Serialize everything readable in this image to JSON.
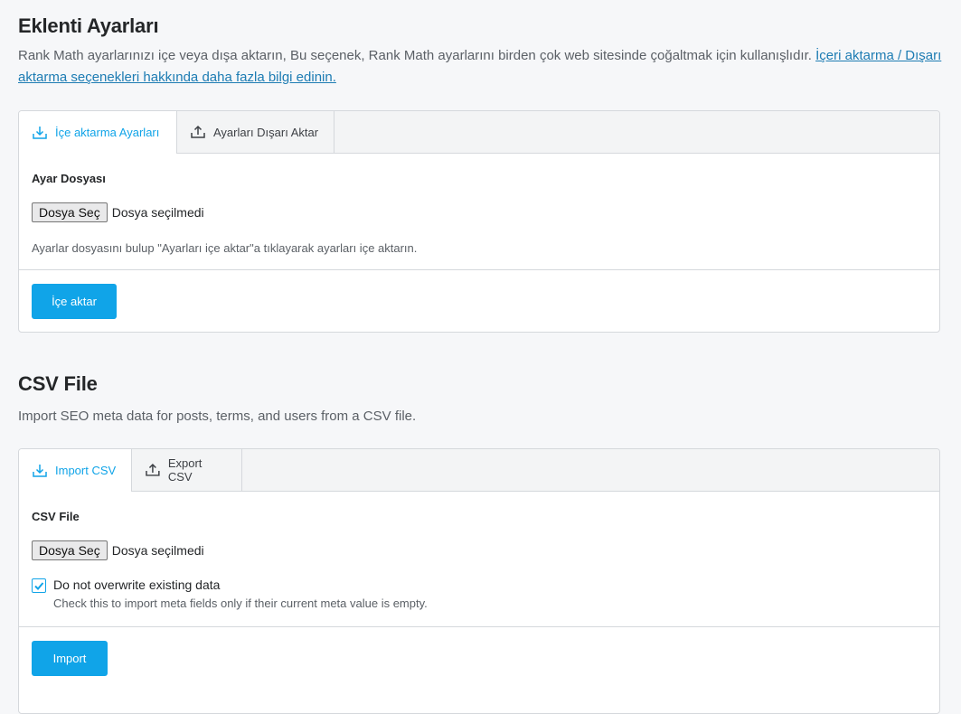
{
  "settings": {
    "title": "Eklenti Ayarları",
    "description": "Rank Math ayarlarınızı içe veya dışa aktarın, Bu seçenek, Rank Math ayarlarını birden çok web sitesinde çoğaltmak için kullanışlıdır. ",
    "link_text": "İçeri aktarma / Dışarı aktarma seçenekleri hakkında daha fazla bilgi edinin.",
    "tabs": [
      {
        "label": "İçe aktarma Ayarları",
        "icon": "download-icon",
        "active": true
      },
      {
        "label": "Ayarları Dışarı Aktar",
        "icon": "upload-icon",
        "active": false
      }
    ],
    "field_label": "Ayar Dosyası",
    "file_button": "Dosya Seç",
    "file_status": "Dosya seçilmedi",
    "hint": "Ayarlar dosyasını bulup \"Ayarları içe aktar\"a tıklayarak ayarları içe aktarın.",
    "submit": "İçe aktar"
  },
  "csv": {
    "title": "CSV File",
    "description": "Import SEO meta data for posts, terms, and users from a CSV file.",
    "tabs": [
      {
        "label": "Import CSV",
        "icon": "download-icon",
        "active": true
      },
      {
        "label": "Export CSV",
        "icon": "upload-icon",
        "active": false
      }
    ],
    "field_label": "CSV File",
    "file_button": "Dosya Seç",
    "file_status": "Dosya seçilmedi",
    "checkbox_label": "Do not overwrite existing data",
    "checkbox_checked": true,
    "checkbox_hint": "Check this to import meta fields only if their current meta value is empty.",
    "submit": "Import"
  },
  "colors": {
    "accent": "#10a4e8",
    "link": "#1d7cb3",
    "background": "#f6f7f9"
  }
}
